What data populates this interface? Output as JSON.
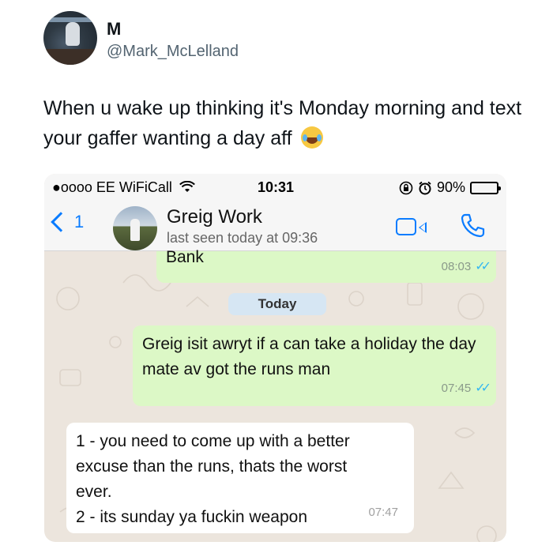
{
  "tweet": {
    "display_name": "M",
    "handle": "@Mark_McLelland",
    "text": "When u wake up thinking it's Monday morning and text your gaffer wanting a day aff",
    "emoji_icon": "face-with-tears-of-joy-emoji"
  },
  "statusbar": {
    "carrier": "●oooo EE WiFiCall",
    "wifi_icon": "wifi-icon",
    "time": "10:31",
    "battery_text": "90%",
    "battery_level": 0.9
  },
  "chat_header": {
    "back_count": "1",
    "contact_name": "Greig Work",
    "last_seen": "last seen today at 09:36"
  },
  "messages": [
    {
      "direction": "out",
      "text": "Bank",
      "time": "08:03",
      "ticks": "✓✓"
    },
    {
      "direction": "out",
      "text": "Greig isit awryt if a can take a holiday the day mate av got the runs man",
      "time": "07:45",
      "ticks": "✓✓"
    },
    {
      "direction": "in",
      "lines": [
        "1 - you need to come up with a better",
        "excuse than the runs, thats the worst",
        "ever.",
        "2 - its sunday ya fuckin weapon"
      ],
      "time": "07:47"
    }
  ],
  "date_divider": "Today",
  "colors": {
    "outgoing_bubble": "#dcf8c6",
    "incoming_bubble": "#ffffff",
    "chat_background": "#ece5dd",
    "ios_blue": "#0a7cff"
  }
}
